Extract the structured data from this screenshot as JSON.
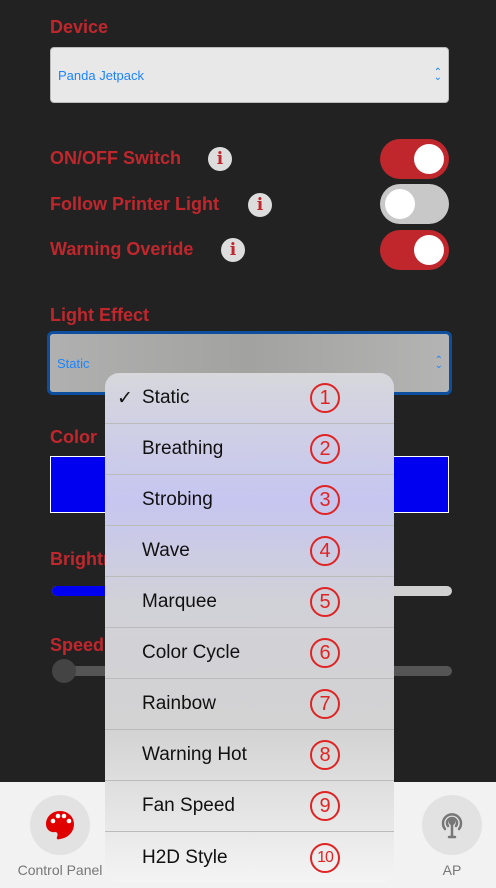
{
  "device": {
    "label": "Device",
    "value": "Panda Jetpack"
  },
  "switches": [
    {
      "label": "ON/OFF Switch",
      "info": "i",
      "on": true
    },
    {
      "label": "Follow Printer Light",
      "info": "i",
      "on": false
    },
    {
      "label": "Warning Overide",
      "info": "i",
      "on": true
    }
  ],
  "light_effect": {
    "label": "Light Effect",
    "value": "Static"
  },
  "color": {
    "label": "Color",
    "value": "#0000f0"
  },
  "brightness": {
    "label": "Brightness"
  },
  "speed": {
    "label": "Speed",
    "value": 0
  },
  "menu": {
    "items": [
      {
        "label": "Static",
        "num": "1",
        "checked": true
      },
      {
        "label": "Breathing",
        "num": "2"
      },
      {
        "label": "Strobing",
        "num": "3"
      },
      {
        "label": "Wave",
        "num": "4"
      },
      {
        "label": "Marquee",
        "num": "5"
      },
      {
        "label": "Color Cycle",
        "num": "6"
      },
      {
        "label": "Rainbow",
        "num": "7"
      },
      {
        "label": "Warning Hot",
        "num": "8"
      },
      {
        "label": "Fan Speed",
        "num": "9"
      },
      {
        "label": "H2D Style",
        "num": "10"
      }
    ],
    "check": "✓"
  },
  "tabbar": {
    "control_panel": "Control Panel",
    "ap": "AP"
  },
  "colors": {
    "accent": "#c0272d",
    "link": "#1a84ff"
  }
}
